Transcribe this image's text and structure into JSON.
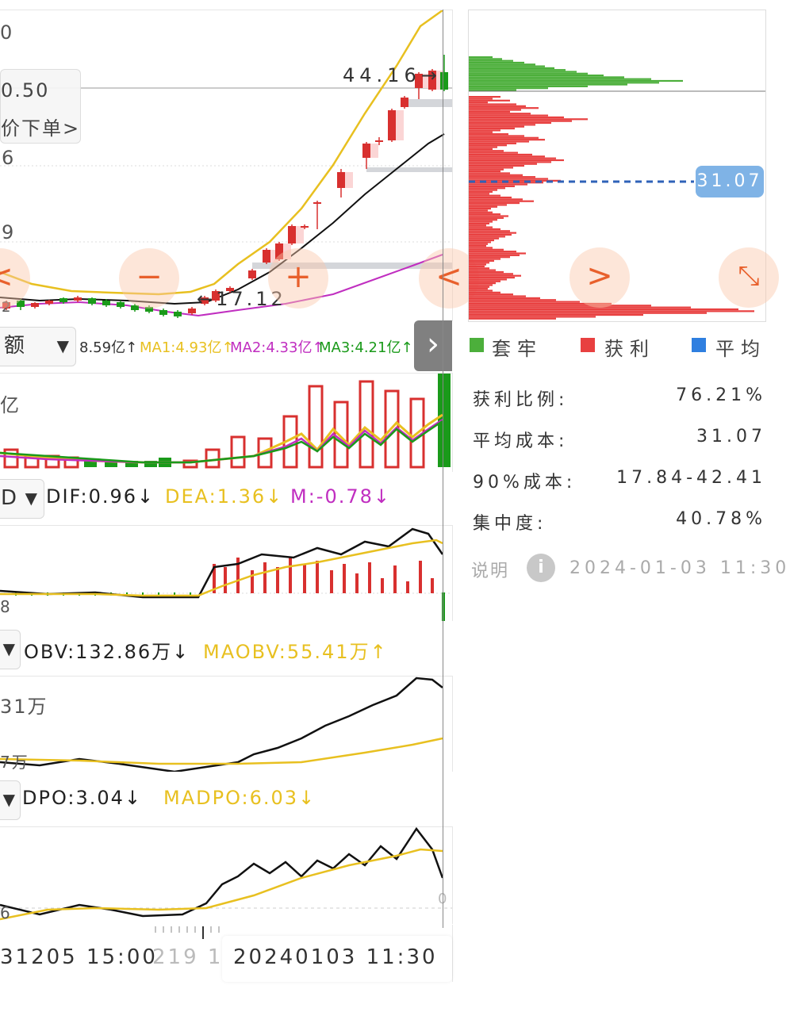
{
  "price_chart": {
    "top_axis_label": "0",
    "price_high_label": "0.50",
    "order_button_label": "价下单",
    "axis_label_mid1": "6",
    "axis_label_mid2": "9",
    "axis_label_low": "2",
    "high_marker": "44.16",
    "low_marker": "17.12",
    "minus_label": "−",
    "plus_label": "+",
    "prev_label": "<",
    "next_label": ">",
    "expand_label": "⤡"
  },
  "volume_header": {
    "selector_label": "额",
    "value": "8.59亿↑",
    "ma1": "MA1:4.93亿↑",
    "ma2": "MA2:4.33亿↑",
    "ma3": "MA3:4.21亿↑",
    "unit_label": "亿",
    "expand_label": "›"
  },
  "macd_header": {
    "selector_label": "D",
    "dif": "DIF:0.96↓",
    "dea": "DEA:1.36↓",
    "m": "M:-0.78↓",
    "axis_low": "8"
  },
  "obv_header": {
    "dif": "OBV:132.86万↓",
    "ma": "MAOBV:55.41万↑",
    "axis_high": "31万",
    "axis_low": "7万"
  },
  "dpo_header": {
    "dpo": "DPO:3.04↓",
    "madpo": "MADPO:6.03↓",
    "axis_low": "6",
    "axis_zero": "0"
  },
  "time_axis": {
    "left_time": "31205 15:00",
    "mid_time": "219 1",
    "right_time": "20240103 11:30"
  },
  "chip_panel": {
    "avg_cost_badge": "31.07",
    "legend": [
      {
        "label": "套牢",
        "color": "#4caf3b"
      },
      {
        "label": "获利",
        "color": "#e84040"
      },
      {
        "label": "平均",
        "color": "#2f7fe0"
      }
    ],
    "stats": [
      {
        "label": "获利比例:",
        "value": "76.21%"
      },
      {
        "label": "平均成本:",
        "value": "31.07"
      },
      {
        "label": "90%成本:",
        "value": "17.84-42.41"
      },
      {
        "label": "集中度:",
        "value": "40.78%"
      }
    ],
    "note_label": "说明",
    "info_icon": "i",
    "timestamp": "2024-01-03 11:30"
  },
  "colors": {
    "up": "#d8302f",
    "down": "#1a9a1a",
    "ma1": "#e8c020",
    "ma2": "#c02ec0",
    "accent": "#e8602c",
    "badge": "#7fb3e6"
  }
}
